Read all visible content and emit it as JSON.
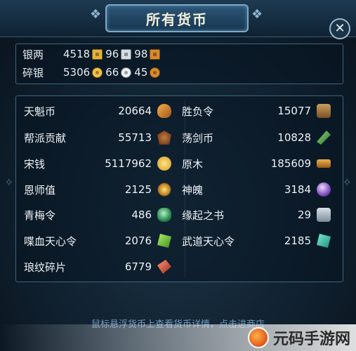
{
  "window": {
    "title": "所有货币",
    "close_label": "✕"
  },
  "silver": [
    {
      "label": "银两",
      "amounts": [
        "4518",
        "96",
        "98"
      ],
      "coins": [
        "gold-square",
        "silver-square",
        "copper-square"
      ]
    },
    {
      "label": "碎银",
      "amounts": [
        "5306",
        "66",
        "45"
      ],
      "coins": [
        "gold-round",
        "silver-round",
        "copper-round"
      ]
    }
  ],
  "currencies": [
    {
      "name": "天魁币",
      "value": "20664",
      "icon": "medal-icon"
    },
    {
      "name": "胜负令",
      "value": "15077",
      "icon": "scroll-icon"
    },
    {
      "name": "帮派贡献",
      "value": "55713",
      "icon": "mask-icon"
    },
    {
      "name": "荡剑币",
      "value": "10828",
      "icon": "dagger-icon"
    },
    {
      "name": "宋钱",
      "value": "5117962",
      "icon": "coin-icon"
    },
    {
      "name": "原木",
      "value": "185609",
      "icon": "wood-icon"
    },
    {
      "name": "恩师值",
      "value": "2125",
      "icon": "spark-icon"
    },
    {
      "name": "神魄",
      "value": "3184",
      "icon": "orb-icon"
    },
    {
      "name": "青梅令",
      "value": "486",
      "icon": "jade-icon"
    },
    {
      "name": "缘起之书",
      "value": "29",
      "icon": "book-icon"
    },
    {
      "name": "喋血天心令",
      "value": "2076",
      "icon": "green-token-icon"
    },
    {
      "name": "武道天心令",
      "value": "2185",
      "icon": "cyan-token-icon"
    },
    {
      "name": "琅纹碎片",
      "value": "6779",
      "icon": "shard-icon"
    }
  ],
  "hint": "鼠标悬浮货币上查看货币详情，点击进商店",
  "watermark": "元码手游网"
}
